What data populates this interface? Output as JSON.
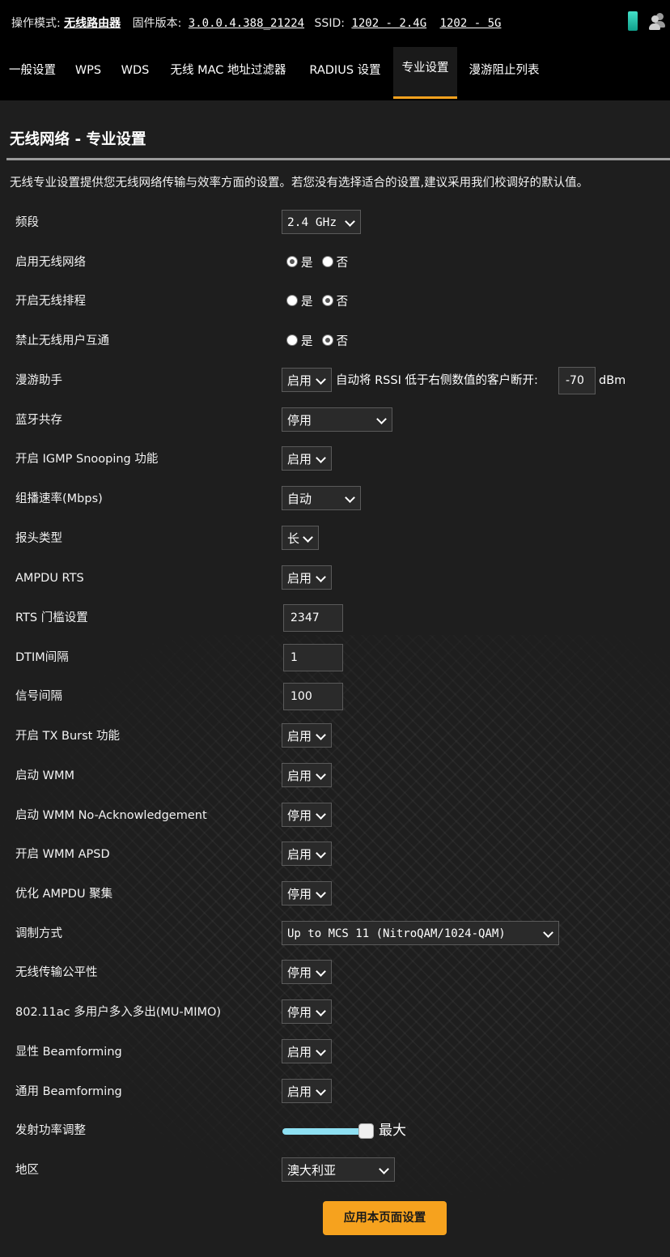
{
  "header": {
    "mode_label": "操作模式:",
    "mode_value": "无线路由器",
    "firmware_label": "固件版本:",
    "firmware_value": "3.0.0.4.388_21224",
    "ssid_label": "SSID:",
    "ssid_24": "1202 - 2.4G",
    "ssid_5": "1202 - 5G",
    "icons": [
      "phone-icon",
      "users-icon"
    ]
  },
  "tabs": [
    {
      "label": "一般设置"
    },
    {
      "label": "WPS"
    },
    {
      "label": "WDS"
    },
    {
      "label": "无线 MAC 地址过滤器"
    },
    {
      "label": "RADIUS 设置"
    },
    {
      "label": "专业设置"
    },
    {
      "label": "漫游阻止列表"
    }
  ],
  "active_tab": "专业设置",
  "page": {
    "title": "无线网络 - 专业设置",
    "description": "无线专业设置提供您无线网络传输与效率方面的设置。若您没有选择适合的设置,建议采用我们校调好的默认值。"
  },
  "radio_labels": {
    "yes": "是",
    "no": "否"
  },
  "settings": {
    "band": {
      "label": "频段",
      "value": "2.4 GHz"
    },
    "enable_wireless": {
      "label": "启用无线网络",
      "selected": "是"
    },
    "wireless_schedule": {
      "label": "开启无线排程",
      "selected": "否"
    },
    "ap_isolation": {
      "label": "禁止无线用户互通",
      "selected": "否"
    },
    "roaming_assistant": {
      "label": "漫游助手",
      "value": "启用",
      "hint": "自动将 RSSI 低于右侧数值的客户断开:",
      "rssi": "-70",
      "unit": "dBm"
    },
    "bt_coexistence": {
      "label": "蓝牙共存",
      "value": "停用"
    },
    "igmp_snooping": {
      "label": "开启 IGMP Snooping 功能",
      "value": "启用"
    },
    "multicast_rate": {
      "label": "组播速率(Mbps)",
      "value": "自动"
    },
    "preamble_type": {
      "label": "报头类型",
      "value": "长"
    },
    "ampdu_rts": {
      "label": "AMPDU RTS",
      "value": "启用"
    },
    "rts_threshold": {
      "label": "RTS 门槛设置",
      "value": "2347"
    },
    "dtim_interval": {
      "label": "DTIM间隔",
      "value": "1"
    },
    "beacon_interval": {
      "label": "信号间隔",
      "value": "100"
    },
    "tx_burst": {
      "label": "开启 TX Burst 功能",
      "value": "启用"
    },
    "wmm": {
      "label": "启动 WMM",
      "value": "启用"
    },
    "wmm_noack": {
      "label": "启动 WMM No-Acknowledgement",
      "value": "停用"
    },
    "wmm_apsd": {
      "label": "开启 WMM APSD",
      "value": "启用"
    },
    "optimize_ampdu": {
      "label": "优化 AMPDU 聚集",
      "value": "停用"
    },
    "modulation": {
      "label": "调制方式",
      "value": "Up to MCS 11 (NitroQAM/1024-QAM)"
    },
    "airtime_fairness": {
      "label": "无线传输公平性",
      "value": "停用"
    },
    "mu_mimo": {
      "label": "802.11ac 多用户多入多出(MU-MIMO)",
      "value": "停用"
    },
    "explicit_bf": {
      "label": "显性 Beamforming",
      "value": "启用"
    },
    "universal_bf": {
      "label": "通用 Beamforming",
      "value": "启用"
    },
    "tx_power": {
      "label": "发射功率调整",
      "value_text": "最大",
      "level": 1.0
    },
    "region": {
      "label": "地区",
      "value": "澳大利亚"
    }
  },
  "apply_button": "应用本页面设置",
  "colors": {
    "accent": "#f6a21e",
    "slider": "#8ee0f2",
    "background": "#1c1c1c"
  }
}
